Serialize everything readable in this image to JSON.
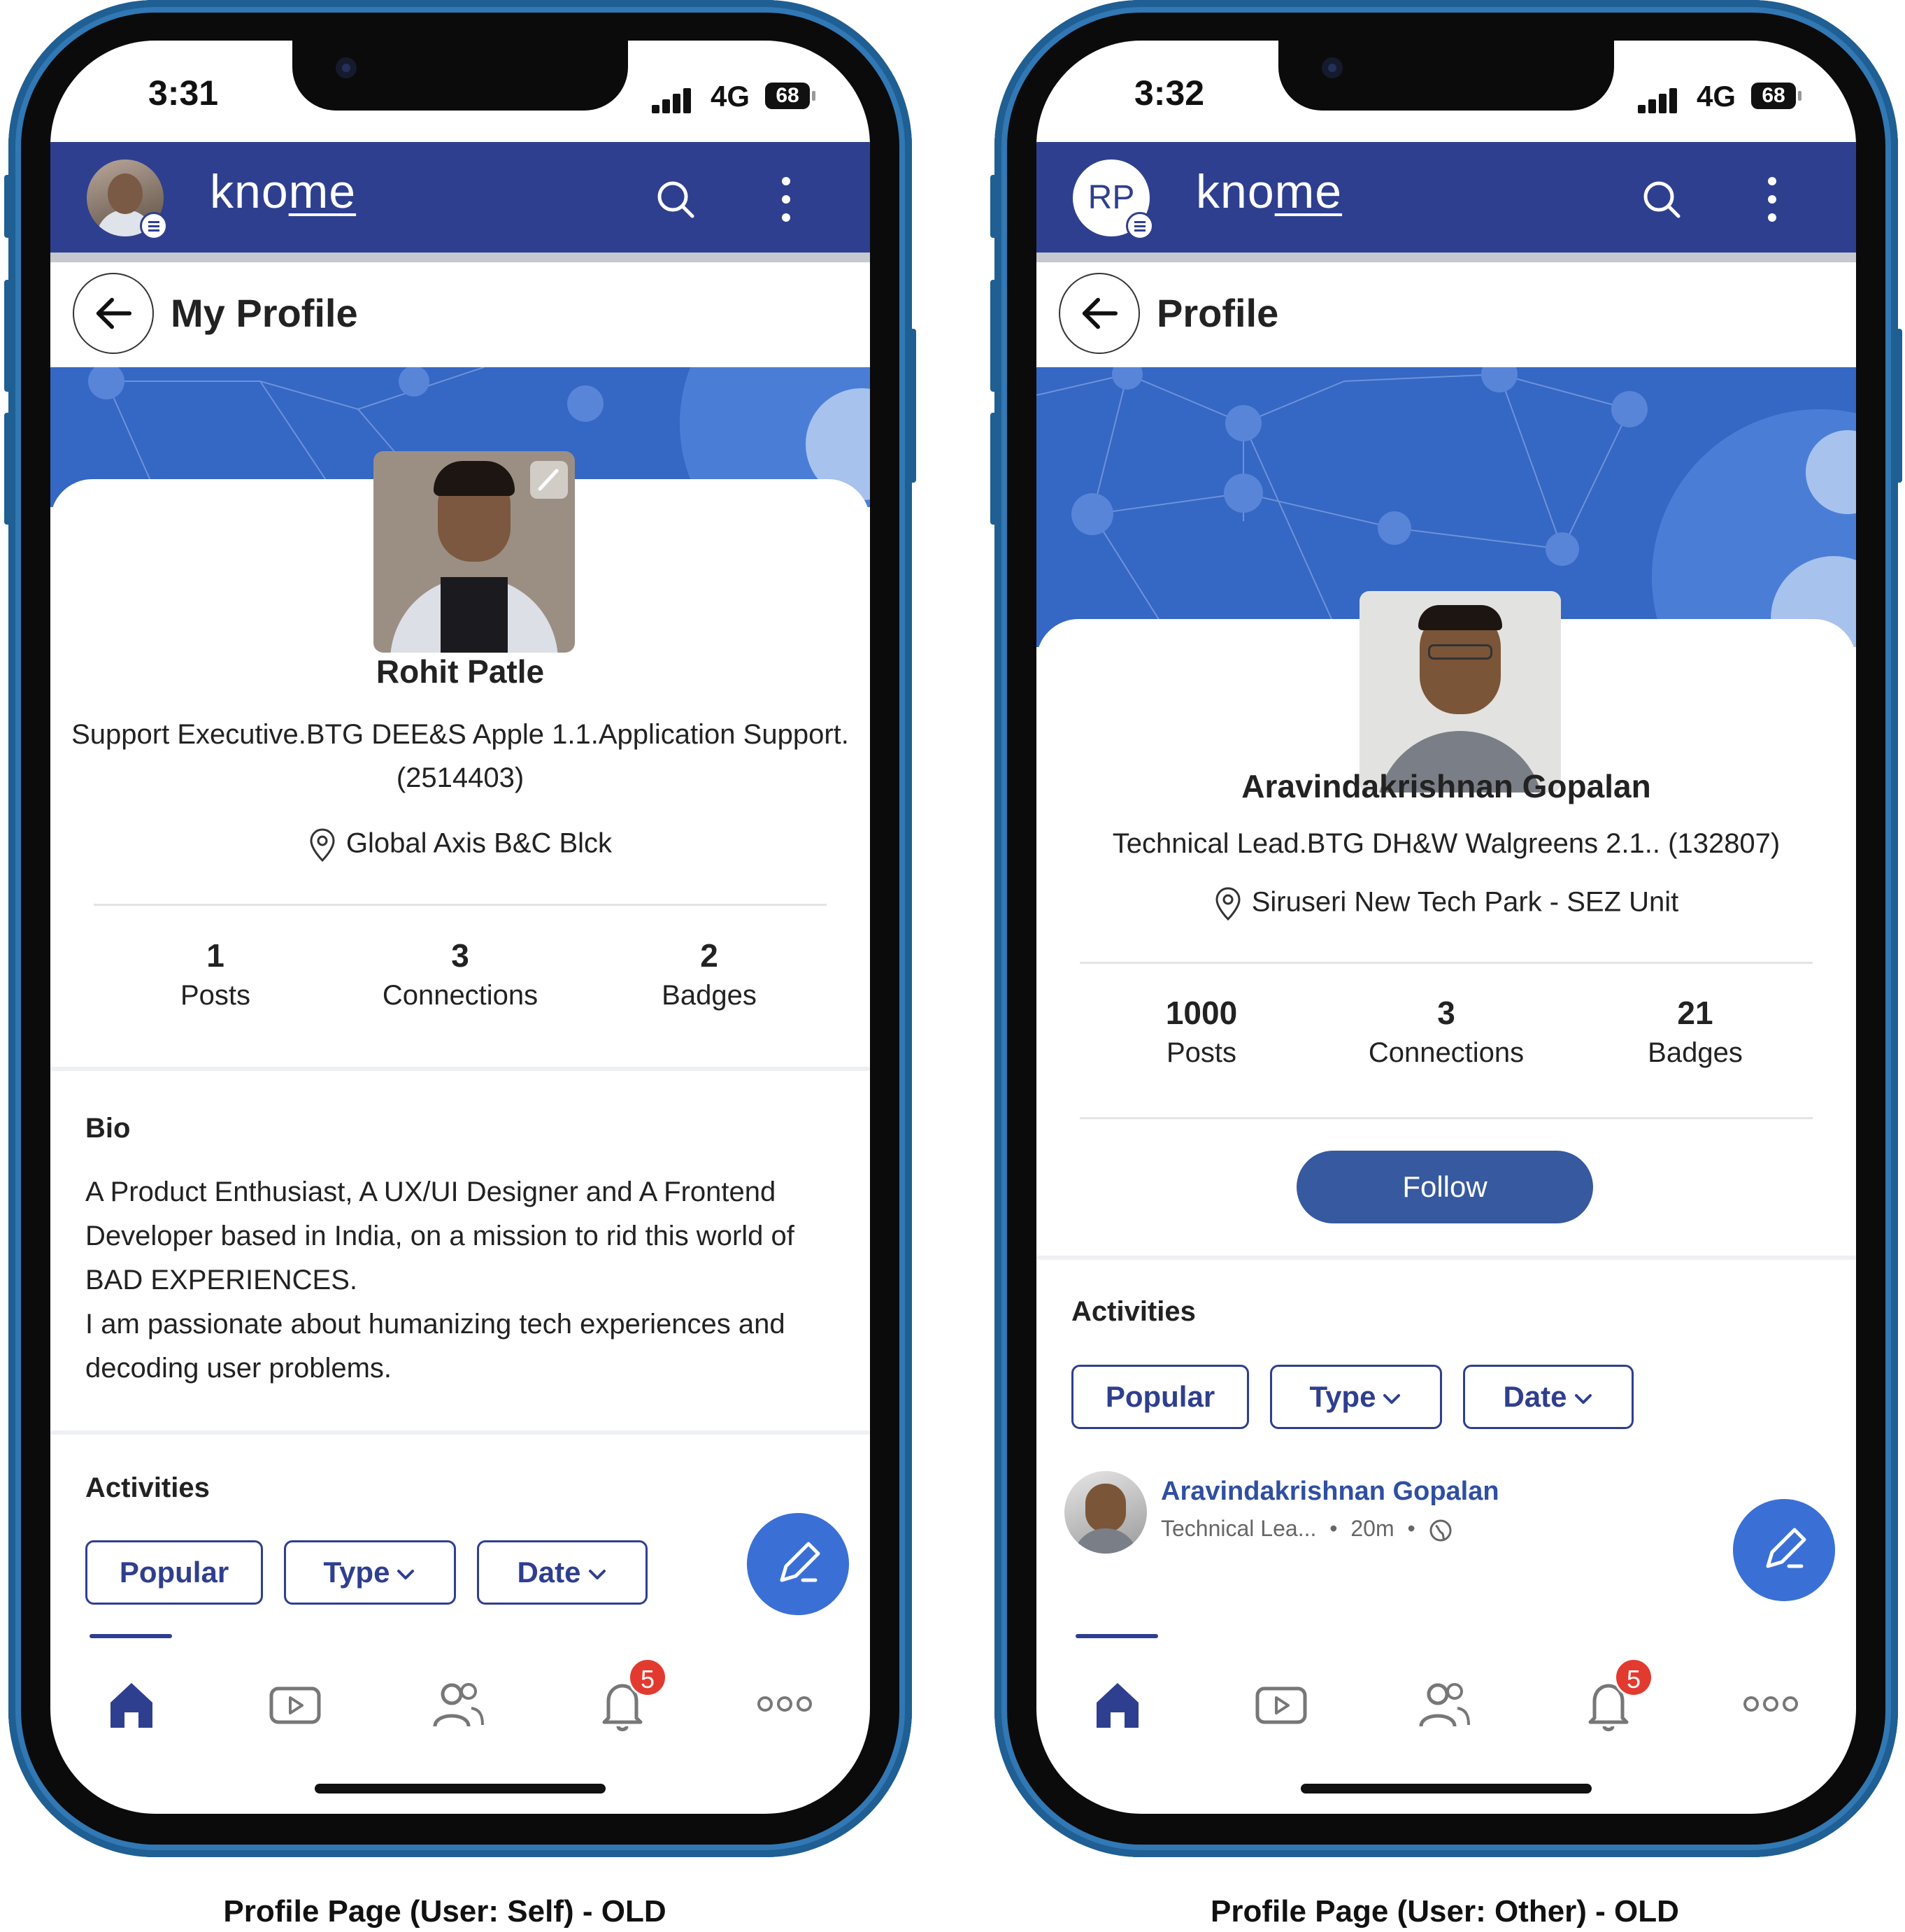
{
  "left_phone": {
    "status": {
      "time": "3:31",
      "network": "4G",
      "battery": "68"
    },
    "app": {
      "logo_prefix": "kno",
      "logo_suffix": "me"
    },
    "page_title": "My Profile",
    "profile": {
      "name": "Rohit Patle",
      "role_line1": "Support Executive.BTG DEE&S Apple 1.1.Application Support.",
      "role_line2": "(2514403)",
      "location": "Global Axis B&C Blck"
    },
    "stats": [
      {
        "value": "1",
        "label": "Posts"
      },
      {
        "value": "3",
        "label": "Connections"
      },
      {
        "value": "2",
        "label": "Badges"
      }
    ],
    "bio": {
      "heading": "Bio",
      "lines": [
        "A Product Enthusiast, A UX/UI Designer and A Frontend",
        "Developer based in India, on a mission to rid this world of",
        "BAD EXPERIENCES.",
        "I am passionate about humanizing tech experiences and",
        "decoding user problems."
      ]
    },
    "activities": {
      "heading": "Activities",
      "filters": [
        "Popular",
        "Type",
        "Date"
      ]
    },
    "nav": {
      "notification_count": "5",
      "active": "home"
    },
    "caption": "Profile Page (User: Self) - OLD"
  },
  "right_phone": {
    "status": {
      "time": "3:32",
      "network": "4G",
      "battery": "68"
    },
    "app": {
      "logo_prefix": "kno",
      "logo_suffix": "me",
      "avatar_initials": "RP"
    },
    "page_title": "Profile",
    "profile": {
      "name": "Aravindakrishnan Gopalan",
      "role_line1": "Technical Lead.BTG DH&W Walgreens 2.1.. (132807)",
      "location": "Siruseri New Tech Park - SEZ Unit"
    },
    "stats": [
      {
        "value": "1000",
        "label": "Posts"
      },
      {
        "value": "3",
        "label": "Connections"
      },
      {
        "value": "21",
        "label": "Badges"
      }
    ],
    "follow_label": "Follow",
    "activities": {
      "heading": "Activities",
      "filters": [
        "Popular",
        "Type",
        "Date"
      ]
    },
    "post": {
      "author": "Aravindakrishnan Gopalan",
      "meta": "Technical Lea...",
      "time": "20m"
    },
    "nav": {
      "notification_count": "5",
      "active": "home"
    },
    "caption": "Profile Page (User: Other) - OLD"
  },
  "colors": {
    "primary": "#2f3f8f",
    "banner": "#3567c4",
    "fab": "#3a70d6",
    "follow": "#36599f",
    "badge": "#e33a2f",
    "frame_edge": "#3178b5"
  }
}
